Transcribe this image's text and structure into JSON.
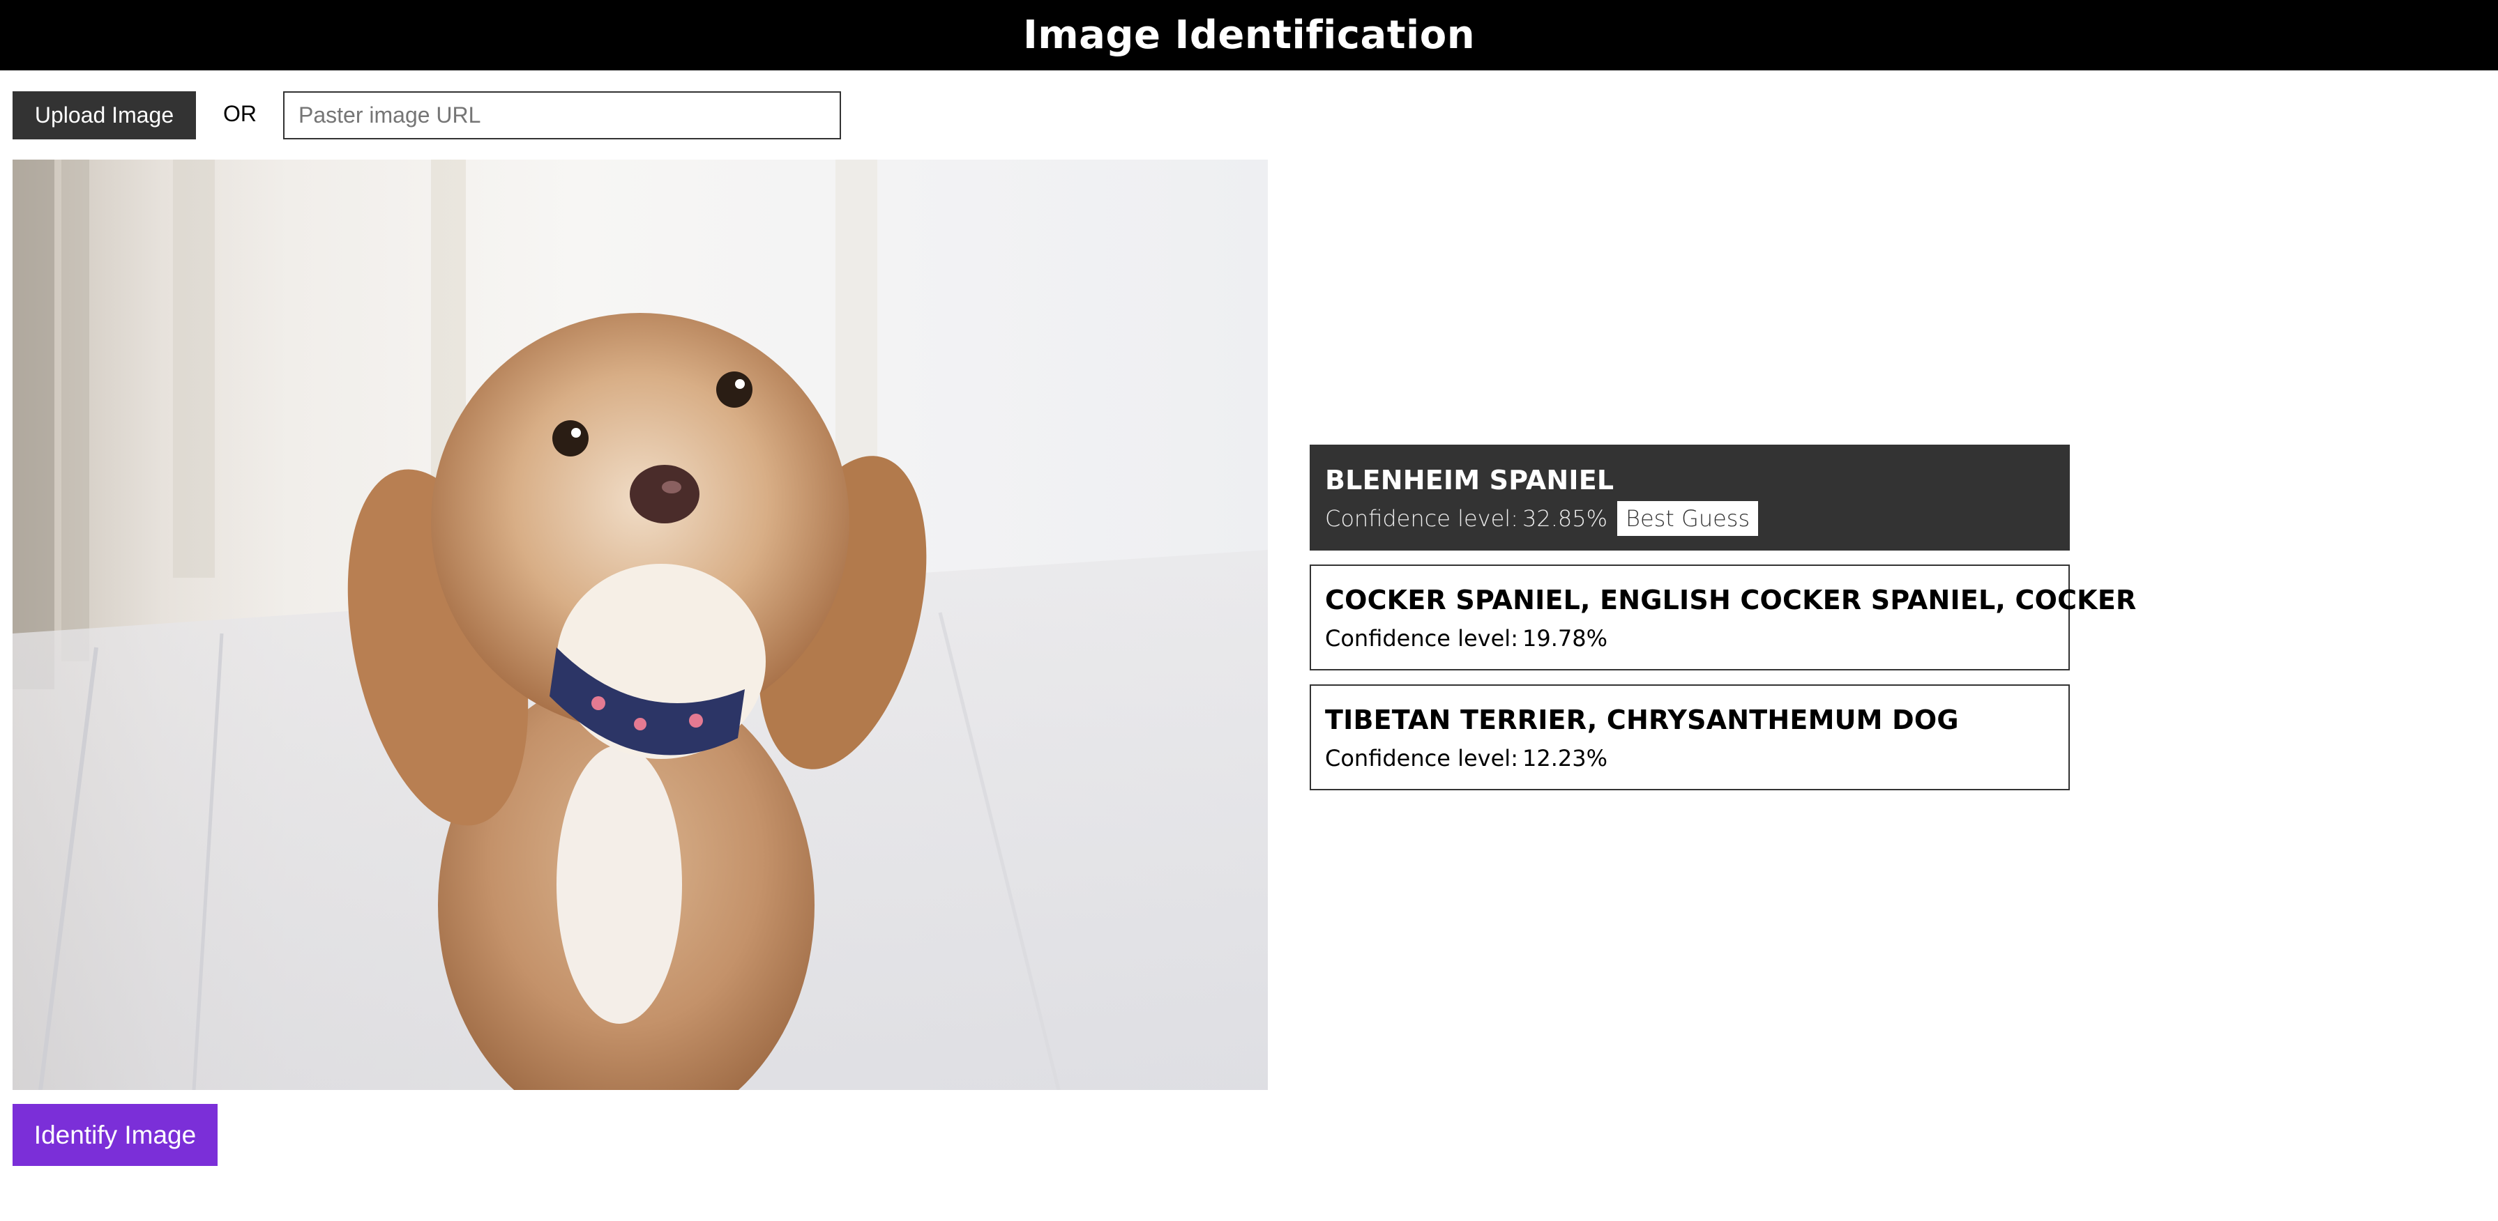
{
  "header": {
    "title": "Image Identification"
  },
  "controls": {
    "upload_label": "Upload Image",
    "or_label": "OR",
    "url_placeholder": "Paster image URL",
    "url_value": ""
  },
  "preview": {
    "alt": "dog photo"
  },
  "identify_label": "Identify Image",
  "results": [
    {
      "title": "BLENHEIM SPANIEL",
      "confidence_label": "Confidence level:",
      "confidence": "32.85%",
      "badge": "Best Guess"
    },
    {
      "title": "COCKER SPANIEL, ENGLISH COCKER SPANIEL, COCKER",
      "confidence_label": "Confidence level:",
      "confidence": "19.78%"
    },
    {
      "title": "TIBETAN TERRIER, CHRYSANTHEMUM DOG",
      "confidence_label": "Confidence level:",
      "confidence": "12.23%"
    }
  ],
  "colors": {
    "header_bg": "#000000",
    "upload_bg": "#333333",
    "identify_bg": "#7b2fd8",
    "best_card_bg": "#333333"
  }
}
